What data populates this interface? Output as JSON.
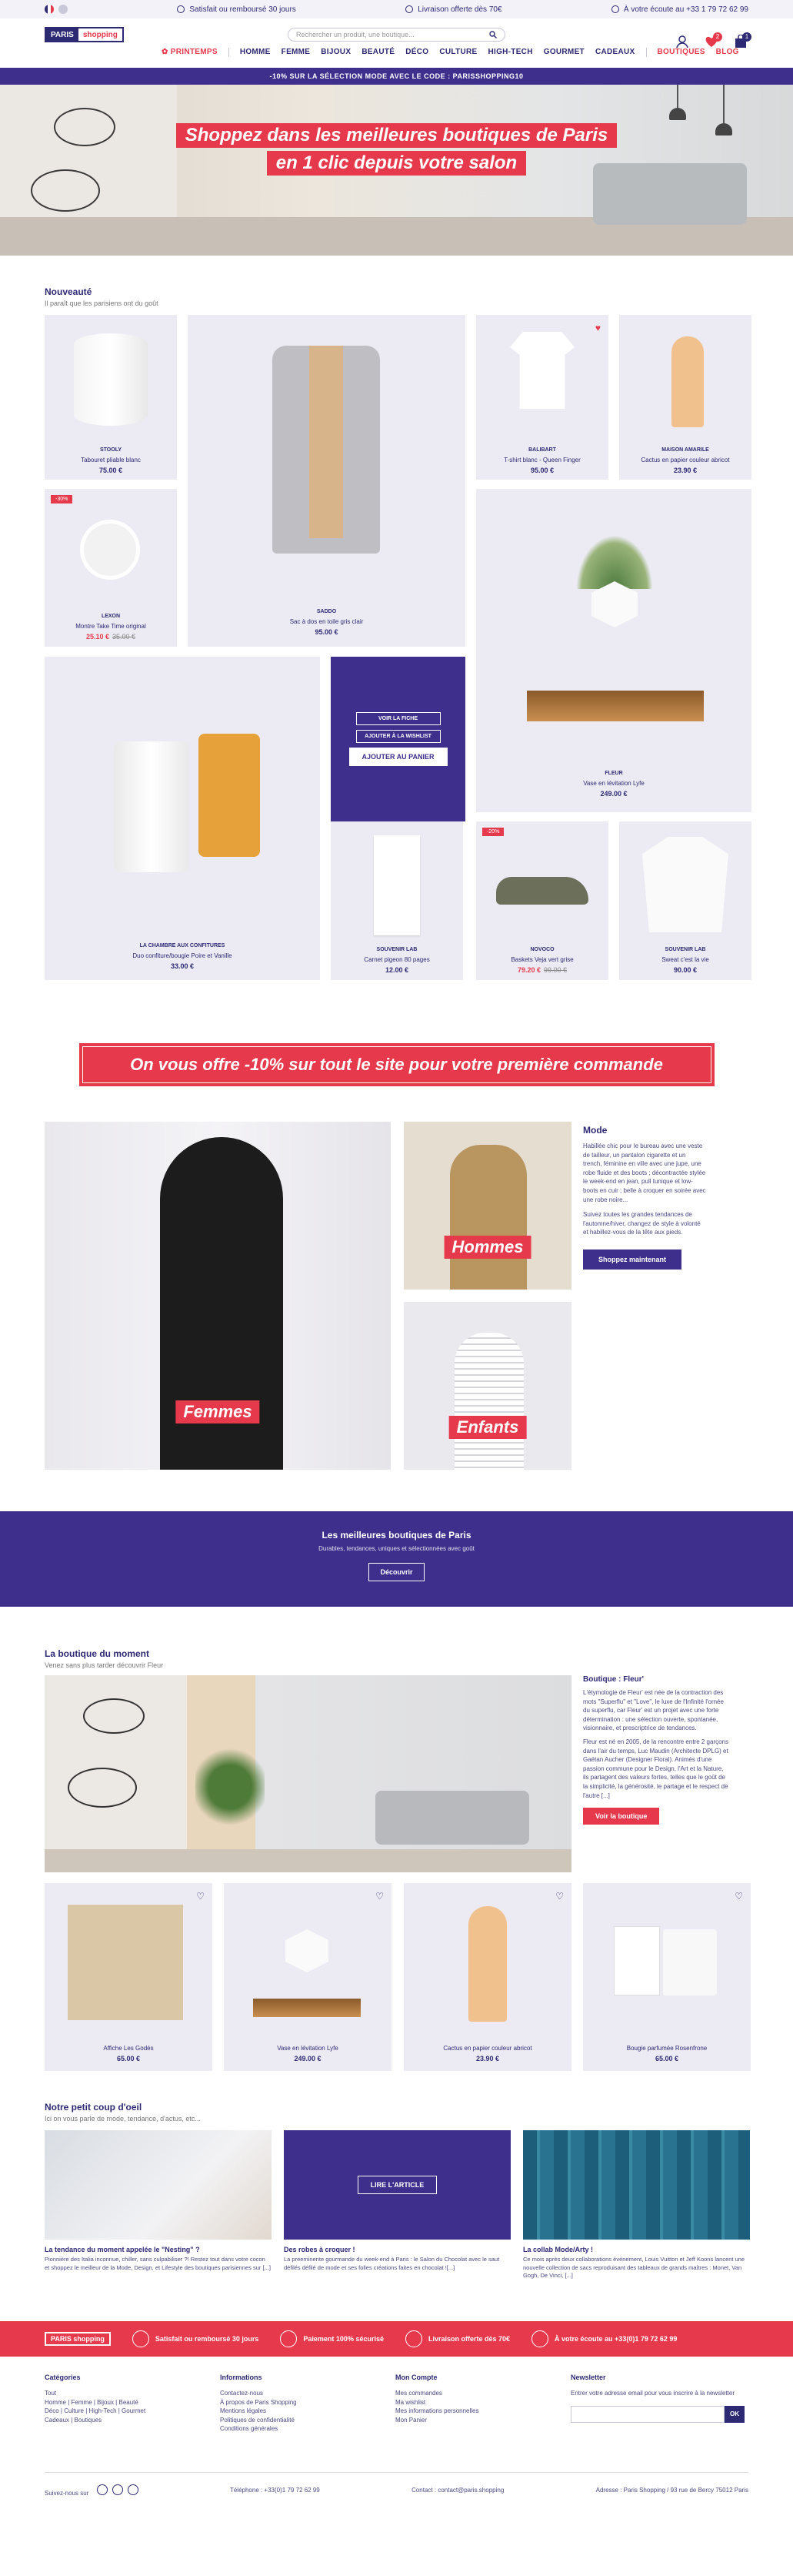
{
  "topbar": {
    "items": [
      "Satisfait ou remboursé 30 jours",
      "Livraison offerte dès 70€",
      "À votre écoute au +33 1 79 72 62 99"
    ]
  },
  "header": {
    "logo_left": "PARIS",
    "logo_right": "shopping",
    "search_placeholder": "Rechercher un produit, une boutique...",
    "nav": [
      "PRINTEMPS",
      "HOMME",
      "FEMME",
      "BIJOUX",
      "BEAUTÉ",
      "DÉCO",
      "CULTURE",
      "HIGH-TECH",
      "GOURMET",
      "CADEAUX",
      "BOUTIQUES",
      "BLOG"
    ],
    "cart_count": "1",
    "wishlist_count": "2"
  },
  "promo_bar": "-10% SUR LA SÉLECTION MODE AVEC LE CODE : PARISSHOPPING10",
  "hero": {
    "line1": "Shoppez dans les meilleures boutiques de Paris",
    "line2": "en 1 clic depuis votre salon"
  },
  "nouveautes": {
    "title": "Nouveauté",
    "subtitle": "Il paraît que les parisiens ont du goût",
    "products": [
      {
        "brand": "STOOLY",
        "name": "Tabouret pliable blanc",
        "price": "75.00 €"
      },
      {
        "brand": "SADDO",
        "name": "Sac à dos en toile gris clair",
        "price": "95.00 €"
      },
      {
        "brand": "BALIBART",
        "name": "T-shirt blanc - Queen Finger",
        "price": "95.00 €"
      },
      {
        "brand": "MAISON AMARILE",
        "name": "Cactus en papier couleur abricot",
        "price": "23.90 €"
      },
      {
        "brand": "LEXON",
        "name": "Montre Take Time original",
        "price": "25.10 €",
        "old": "35.00 €",
        "tag": "-30%"
      },
      {
        "brand": "FLEUR",
        "name": "Vase en lévitation Lyfe",
        "price": "249.00 €"
      },
      {
        "brand": "LA CHAMBRE AUX CONFITURES",
        "name": "Duo confiture/bougie Poire et Vanille",
        "price": "33.00 €"
      },
      {
        "brand": "SOUVENIR LAB",
        "name": "Carnet pigeon 80 pages",
        "price": "12.00 €"
      },
      {
        "brand": "NOVOCO",
        "name": "Baskets Veja vert grise",
        "price": "79.20 €",
        "old": "99.00 €",
        "tag": "-20%"
      },
      {
        "brand": "SOUVENIR LAB",
        "name": "Sweat c'est la vie",
        "price": "90.00 €"
      }
    ],
    "overlay": {
      "btn1": "VOIR LA FICHE",
      "btn2": "AJOUTER À LA WISHLIST",
      "btn3": "AJOUTER AU PANIER"
    }
  },
  "offer": "On vous offre -10% sur tout le site pour votre première commande",
  "mode": {
    "labels": [
      "Femmes",
      "Hommes",
      "Enfants"
    ],
    "title": "Mode",
    "p1": "Habillée chic pour le bureau avec une veste de tailleur, un pantalon cigarette et un trench, féminine en ville avec une jupe, une robe fluide et des boots ; décontractée stylée le week-end en jean, pull tunique et low-boots en cuir ; belle à croquer en soirée avec une robe noire...",
    "p2": "Suivez toutes les grandes tendances de l'automne/hiver, changez de style à volonté et habillez-vous de la tête aux pieds.",
    "btn": "Shoppez maintenant"
  },
  "band": {
    "title": "Les meilleures boutiques de Paris",
    "subtitle": "Durables, tendances, uniques et sélectionnées avec goût",
    "btn": "Découvrir"
  },
  "boutique": {
    "title": "La boutique du moment",
    "subtitle": "Venez sans plus tarder découvrir Fleur",
    "heading": "Boutique : Fleur'",
    "p1": "L'étymologie de Fleur' est née de la contraction des mots \"Superflu\" et \"Love\", le luxe de l'Infinité l'ornée du superflu, car Fleur' est un projet avec une forte détermination : une sélection ouverte, spontanée, visionnaire, et prescriptrice de tendances.",
    "p2": "Fleur est né en 2005, de la rencontre entre 2 garçons dans l'air du temps, Luc Maudin (Architecte DPLG) et Gaëtan Aucher (Designer Floral). Animés d'une passion commune pour le Design, l'Art et la Nature, ils partagent des valeurs fortes, telles que le goût de la simplicité, la générosité, le partage et le respect de l'autre [...]",
    "btn": "Voir la boutique",
    "products": [
      {
        "name": "Affiche Les Godés",
        "price": "65.00 €"
      },
      {
        "name": "Vase en lévitation Lyfe",
        "price": "249.00 €"
      },
      {
        "name": "Cactus en papier couleur abricot",
        "price": "23.90 €"
      },
      {
        "name": "Bougie parfumée Rosenfrone",
        "price": "65.00 €"
      }
    ]
  },
  "blog": {
    "title": "Notre petit coup d'oeil",
    "subtitle": "Ici on vous parle de mode, tendance, d'actus, etc...",
    "overlay_btn": "LIRE L'ARTICLE",
    "posts": [
      {
        "title": "La tendance du moment appelée le \"Nesting\" ?",
        "text": "Pionnière des Italia inconnue, chiller, sans culpabiliser ?! Restez tout dans votre cocon et shoppez le meilleur de la Mode, Design, et Lifestyle des boutiques parisiennes sur [...]"
      },
      {
        "title": "Des robes à croquer !",
        "text": "La preeminente gourmande du week-end à Paris : le Salon du Chocolat avec le saut défilés défilé de mode et ses folles créations faites en chocolat ![...]"
      },
      {
        "title": "La collab Mode/Arty !",
        "text": "Ce mois après deux collaborations événement, Louis Vuitton et Jeff Koons lancent une nouvelle collection de sacs reproduisant des tableaux de grands maîtres : Monet, Van Gogh, De Vinci, [...]"
      }
    ]
  },
  "reassurance": [
    "Satisfait ou remboursé 30 jours",
    "Paiement 100% sécurisé",
    "Livraison offerte dès 70€",
    "À votre écoute au +33(0)1 79 72 62 99"
  ],
  "footer": {
    "cols": [
      {
        "title": "Catégories",
        "links": [
          "Tout",
          "Homme | Femme | Bijoux | Beauté",
          "Déco | Culture | High-Tech | Gourmet",
          "Cadeaux | Boutiques"
        ]
      },
      {
        "title": "Informations",
        "links": [
          "Contactez-nous",
          "À propos de Paris Shopping",
          "Mentions légales",
          "Politiques de confidentialité",
          "Conditions générales"
        ]
      },
      {
        "title": "Mon Compte",
        "links": [
          "Mes commandes",
          "Ma wishlist",
          "Mes informations personnelles",
          "Mon Panier"
        ]
      }
    ],
    "newsletter_title": "Newsletter",
    "newsletter_text": "Entrer votre adresse email pour vous inscrire à la newsletter",
    "newsletter_btn": "OK",
    "follow": "Suivez-nous sur",
    "phone": "Téléphone : +33(0)1 79 72 62 99",
    "contact": "Contact : contact@paris.shopping",
    "address": "Adresse : Paris Shopping / 93 rue de Bercy 75012 Paris"
  }
}
